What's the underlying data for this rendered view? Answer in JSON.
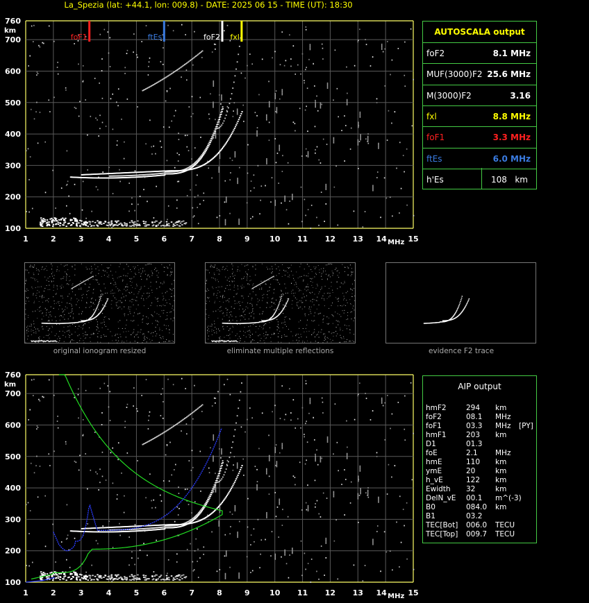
{
  "header": {
    "title": "La_Spezia (lat: +44.1, lon: 009.8) - DATE: 2025 06 15 - TIME (UT): 18:30"
  },
  "axes": {
    "y_unit": "km",
    "x_unit": "MHz",
    "y_ticks": [
      "760",
      "700",
      "600",
      "500",
      "400",
      "300",
      "200",
      "100"
    ],
    "x_ticks": [
      "1",
      "2",
      "3",
      "4",
      "5",
      "6",
      "7",
      "8",
      "9",
      "10",
      "11",
      "12",
      "13",
      "14",
      "15"
    ]
  },
  "markers": [
    {
      "label": "foF1",
      "freq": 3.3,
      "color": "#ff2020"
    },
    {
      "label": "ftEs",
      "freq": 6.0,
      "color": "#3a7be0"
    },
    {
      "label": "foF2",
      "freq": 8.1,
      "color": "#ffffff"
    },
    {
      "label": "fxl",
      "freq": 8.8,
      "color": "#ffff00"
    }
  ],
  "autoscala": {
    "title": "AUTOSCALA output",
    "rows": [
      {
        "key": "foF2",
        "value": "8.1 MHz",
        "color": "#ffffff"
      },
      {
        "key": "MUF(3000)F2",
        "value": "25.6 MHz",
        "color": "#ffffff"
      },
      {
        "key": "M(3000)F2",
        "value": "3.16",
        "color": "#ffffff"
      },
      {
        "key": "fxl",
        "value": "8.8 MHz",
        "color": "#ffff00"
      },
      {
        "key": "foF1",
        "value": "3.3 MHz",
        "color": "#ff2020"
      },
      {
        "key": "ftEs",
        "value": "6.0 MHz",
        "color": "#3a7be0"
      },
      {
        "key": "h'Es",
        "value": "108",
        "unit": "km",
        "color": "#ffffff"
      }
    ]
  },
  "thumbnails": [
    {
      "caption": "original ionogram resized"
    },
    {
      "caption": "eliminate multiple reflections"
    },
    {
      "caption": "evidence F2 trace"
    }
  ],
  "aip": {
    "title": "AIP output",
    "rows": [
      {
        "name": "hmF2",
        "value": "294",
        "unit": "km",
        "flag": ""
      },
      {
        "name": "foF2",
        "value": "08.1",
        "unit": "MHz",
        "flag": ""
      },
      {
        "name": "foF1",
        "value": "03.3",
        "unit": "MHz",
        "flag": "[PY]"
      },
      {
        "name": "hmF1",
        "value": "203",
        "unit": "km",
        "flag": ""
      },
      {
        "name": "D1",
        "value": "01.3",
        "unit": "",
        "flag": ""
      },
      {
        "name": "foE",
        "value": "2.1",
        "unit": "MHz",
        "flag": ""
      },
      {
        "name": "hmE",
        "value": "110",
        "unit": "km",
        "flag": ""
      },
      {
        "name": "ymE",
        "value": "20",
        "unit": "km",
        "flag": ""
      },
      {
        "name": "h_vE",
        "value": "122",
        "unit": "km",
        "flag": ""
      },
      {
        "name": "Ewidth",
        "value": "32",
        "unit": "km",
        "flag": ""
      },
      {
        "name": "DelN_vE",
        "value": "00.1",
        "unit": "m^(-3)",
        "flag": ""
      },
      {
        "name": "B0",
        "value": "084.0",
        "unit": "km",
        "flag": ""
      },
      {
        "name": "B1",
        "value": "03.2",
        "unit": "",
        "flag": ""
      },
      {
        "name": "TEC[Bot]",
        "value": "006.0",
        "unit": "TECU",
        "flag": ""
      },
      {
        "name": "TEC[Top]",
        "value": "009.7",
        "unit": "TECU",
        "flag": ""
      }
    ]
  },
  "colors": {
    "frame": "#ffff66",
    "grid": "#5a5a5a",
    "panel_border": "#44cc44",
    "profile_green": "#22dd22",
    "profile_blue": "#2a3cff"
  }
}
